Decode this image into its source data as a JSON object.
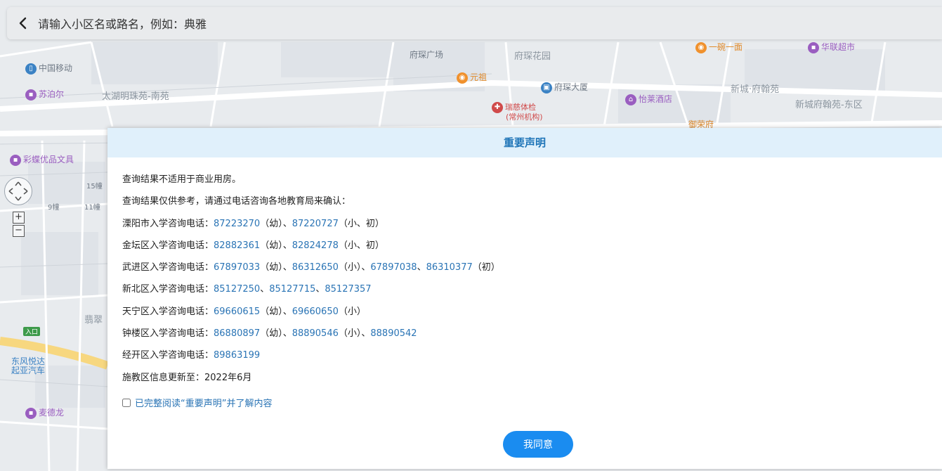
{
  "search": {
    "placeholder": "请输入小区名或路名，例如：典雅"
  },
  "map_labels": {
    "zhongguo_yidong": "中国移动",
    "subo_er": "苏泊尔",
    "taihu_mingzhu": "太湖明珠苑-南苑",
    "fuchuan_guangchang": "府琛广场",
    "fuchuan_huayuan": "府琛花园",
    "yuanzu": "元祖",
    "fuchuan_dasha": "府琛大厦",
    "ruici_tijian": "瑞慈体检",
    "ruici_sub": "(常州机构)",
    "yilai_jiudian": "怡莱酒店",
    "xincheng_fuhanyuan": "新城·府翰苑",
    "xincheng_fuhanyuan_east": "新城府翰苑-东区",
    "hualian_chaoshi": "华联超市",
    "yiwan_yimian": "一碗一面",
    "yurongfu": "御荣府",
    "caidie_wenju": "彩蝶优品文具",
    "building_15": "15幢",
    "building_9": "9幢",
    "building_11": "11幢",
    "feicui": "翡翠",
    "dongfeng": "东风悦达",
    "qiya": "起亚汽车",
    "maidelong": "麦德龙",
    "entrance": "入口"
  },
  "modal": {
    "title": "重要声明",
    "line1": "查询结果不适用于商业用房。",
    "line2": "查询结果仅供参考，请通过电话咨询各地教育局来确认：",
    "liyang": {
      "label": "溧阳市入学咨询电话：",
      "p1": "87223270",
      "t1": "（幼）、",
      "p2": "87220727",
      "t2": "（小、初）"
    },
    "jintan": {
      "label": "金坛区入学咨询电话：",
      "p1": "82882361",
      "t1": "（幼）、",
      "p2": "82824278",
      "t2": "（小、初）"
    },
    "wujin": {
      "label": "武进区入学咨询电话：",
      "p1": "67897033",
      "t1": "（幼）、",
      "p2": "86312650",
      "t2": "（小）、",
      "p3": "67897038",
      "t3": "、",
      "p4": "86310377",
      "t4": "（初）"
    },
    "xinbei": {
      "label": "新北区入学咨询电话：",
      "p1": "85127250",
      "t1": "、",
      "p2": "85127715",
      "t2": "、",
      "p3": "85127357"
    },
    "tianning": {
      "label": "天宁区入学咨询电话：",
      "p1": "69660615",
      "t1": "（幼）、",
      "p2": "69660650",
      "t2": "（小）"
    },
    "zhonglou": {
      "label": "钟楼区入学咨询电话：",
      "p1": "86880897",
      "t1": "（幼）、",
      "p2": "88890546",
      "t2": "（小）、",
      "p3": "88890542"
    },
    "jingkai": {
      "label": "经开区入学咨询电话：",
      "p1": "89863199"
    },
    "update": "施教区信息更新至：2022年6月",
    "confirm_label": "已完整阅读“重要声明”并了解内容",
    "agree_button": "我同意"
  },
  "colors": {
    "accent": "#1a8cf0",
    "header_bg": "#e0f0fb",
    "link": "#2a74b5"
  }
}
